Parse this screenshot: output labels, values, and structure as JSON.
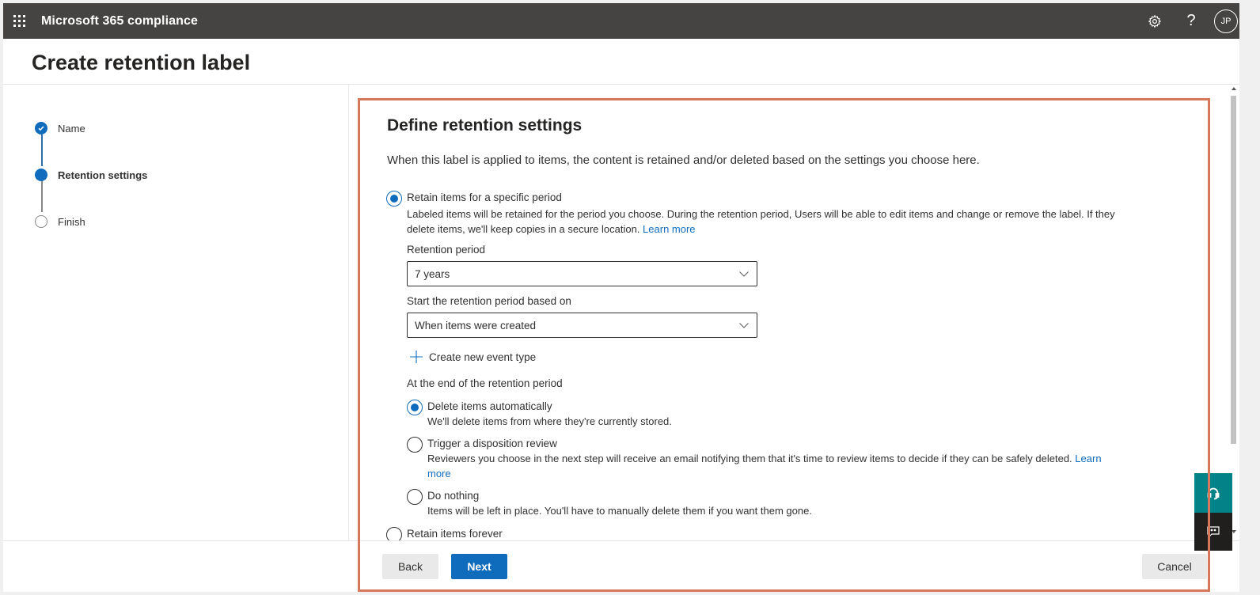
{
  "topbar": {
    "app_title": "Microsoft 365 compliance",
    "icons": [
      "app-launcher-icon",
      "settings-gear-icon",
      "help-question-icon"
    ],
    "help_glyph": "?",
    "avatar_initials": "JP"
  },
  "page": {
    "title": "Create retention label"
  },
  "wizard_steps": [
    {
      "label": "Name",
      "state": "completed"
    },
    {
      "label": "Retention settings",
      "state": "current"
    },
    {
      "label": "Finish",
      "state": "pending"
    }
  ],
  "main": {
    "section_title": "Define retention settings",
    "intro": "When this label is applied to items, the content is retained and/or deleted based on the settings you choose here.",
    "retain_specific": {
      "label": "Retain items for a specific period",
      "checked": true,
      "description_line1": "Labeled items will be retained for the period you choose. During the retention period, Users will be able to edit items and change or remove the label. If they",
      "description_line2": "delete items, we'll keep copies in a secure location.",
      "learn_more": "Learn more"
    },
    "retention_period": {
      "label": "Retention period",
      "value": "7 years"
    },
    "start_based_on": {
      "label": "Start the retention period based on",
      "value": "When items were created"
    },
    "create_event_type": "Create new event type",
    "end_of_period": {
      "label": "At the end of the retention period",
      "options": [
        {
          "label": "Delete items automatically",
          "checked": true,
          "description": "We'll delete items from where they're currently stored."
        },
        {
          "label": "Trigger a disposition review",
          "checked": false,
          "description": "Reviewers you choose in the next step will receive an email notifying them that it's time to review items to decide if they can be safely deleted.",
          "learn_more_part1": "Learn",
          "learn_more_part2": "more"
        },
        {
          "label": "Do nothing",
          "checked": false,
          "description": "Items will be left in place. You'll have to manually delete them if you want them gone."
        }
      ]
    },
    "retain_forever": {
      "label": "Retain items forever",
      "checked": false
    }
  },
  "footer": {
    "back": "Back",
    "next": "Next",
    "cancel": "Cancel"
  },
  "colors": {
    "topbar": "#464442",
    "accent": "#0f6cbd",
    "highlight_border": "#d7785a",
    "help_button": "#038387",
    "feedback_button": "#201f1e"
  }
}
